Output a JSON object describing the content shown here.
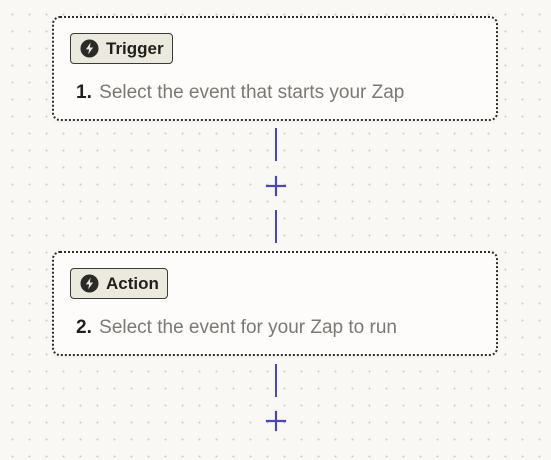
{
  "steps": [
    {
      "badge_label": "Trigger",
      "badge_icon": "lightning-bolt-icon",
      "number": "1.",
      "description": "Select the event that starts your Zap"
    },
    {
      "badge_label": "Action",
      "badge_icon": "lightning-bolt-icon",
      "number": "2.",
      "description": "Select the event for your Zap to run"
    }
  ],
  "add_step_icon": "plus-icon",
  "colors": {
    "connector": "#4f46b5",
    "badge_background": "#ece9df",
    "canvas_background": "#f9f8f5"
  }
}
